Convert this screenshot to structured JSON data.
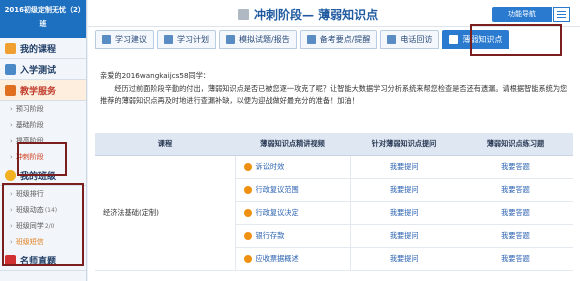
{
  "sidebar": {
    "header": "2016初级定制无忧（2）班",
    "sections": [
      {
        "label": "我的课程",
        "icon": "book-icon"
      },
      {
        "label": "入学测试",
        "icon": "pen-icon"
      },
      {
        "label": "教学服务",
        "icon": "graduation-icon"
      }
    ],
    "teach_items": [
      "预习阶段",
      "基础阶段",
      "提高阶段",
      "冲刺阶段"
    ],
    "class_section": {
      "label": "我的班级",
      "icon": "star-icon"
    },
    "class_items": [
      {
        "label": "班级排行",
        "count": ""
      },
      {
        "label": "班级动态",
        "count": "(14)"
      },
      {
        "label": "班级同学",
        "count": "2/0"
      },
      {
        "label": "班级短信",
        "count": ""
      }
    ],
    "bottom_section": {
      "label": "名师直题",
      "icon": "red-icon"
    }
  },
  "header": {
    "title": "冲刺阶段— 薄弱知识点",
    "func_button": "功能导航",
    "menu_icon": "hamburger-icon"
  },
  "tabs": [
    {
      "label": "学习建议"
    },
    {
      "label": "学习计划"
    },
    {
      "label": "模拟试题/报告"
    },
    {
      "label": "备考要点/提醒"
    },
    {
      "label": "电话回访"
    },
    {
      "label": "薄弱知识点"
    }
  ],
  "intro": {
    "greeting": "亲爱的2016wangkaijcs58同学：",
    "body": "经历过前面阶段辛勤的付出，薄弱知识点是否已被您逐一攻克了呢？让智能大数据学习分析系统来帮您检查是否还有遗漏。请根据智能系统为您推荐的薄弱知识点再及时地进行查漏补缺，以便为迎战做好最充分的准备！加油！"
  },
  "table": {
    "headers": [
      "课程",
      "薄弱知识点精讲视频",
      "针对薄弱知识点提问",
      "薄弱知识点练习题"
    ],
    "course": "经济法基础(定制)",
    "rows": [
      {
        "topic": "诉讼时效",
        "ask": "我要提问",
        "practice": "我要答题"
      },
      {
        "topic": "行政复议范围",
        "ask": "我要提问",
        "practice": "我要答题"
      },
      {
        "topic": "行政复议决定",
        "ask": "我要提问",
        "practice": "我要答题"
      },
      {
        "topic": "银行存款",
        "ask": "我要提问",
        "practice": "我要答题"
      },
      {
        "topic": "应收票据概述",
        "ask": "我要提问",
        "practice": "我要答题"
      }
    ]
  }
}
